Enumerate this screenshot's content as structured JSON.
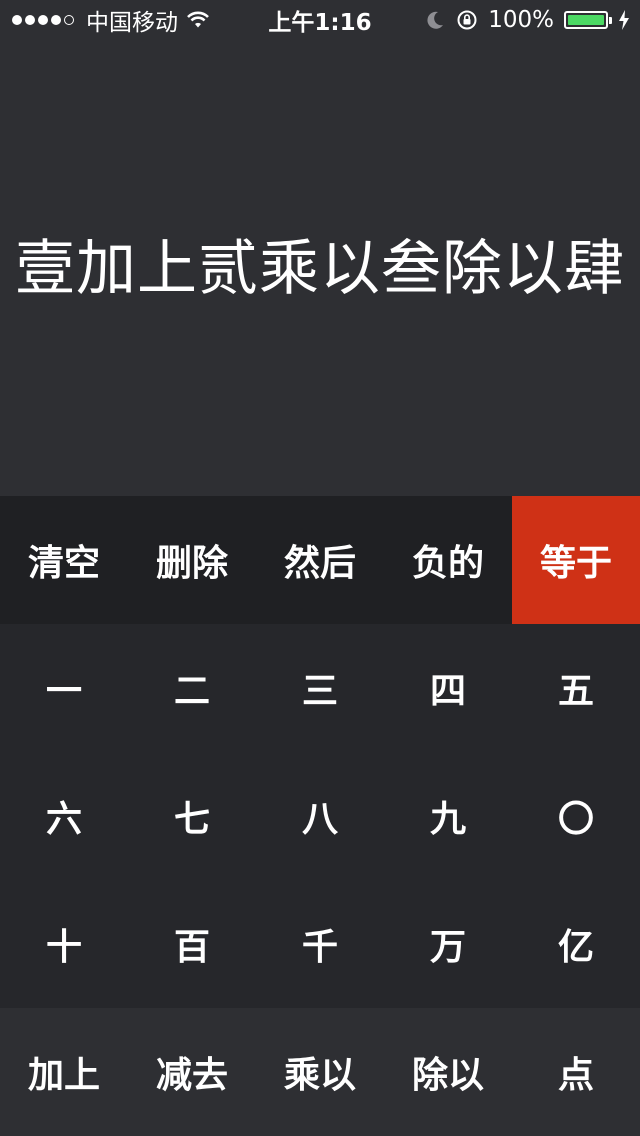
{
  "status_bar": {
    "carrier": "中国移动",
    "time": "上午1:16",
    "battery_percent": "100%",
    "signal_bars_filled": 4,
    "signal_bars_total": 5,
    "battery_level": 1.0,
    "colors": {
      "battery": "#4cd964"
    }
  },
  "display": {
    "expression": "壹加上贰乘以叁除以肆"
  },
  "keys": {
    "function_row": [
      "清空",
      "删除",
      "然后",
      "负的",
      "等于"
    ],
    "digit_rows": [
      [
        "一",
        "二",
        "三",
        "四",
        "五"
      ],
      [
        "六",
        "七",
        "八",
        "九",
        "〇"
      ],
      [
        "十",
        "百",
        "千",
        "万",
        "亿"
      ]
    ],
    "operator_row": [
      "加上",
      "减去",
      "乘以",
      "除以",
      "点"
    ]
  },
  "colors": {
    "background": "#2e2f33",
    "function_row_bg": "#1f2023",
    "digits_bg": "#26272b",
    "equals_accent": "#cf3116",
    "text": "#ffffff"
  }
}
